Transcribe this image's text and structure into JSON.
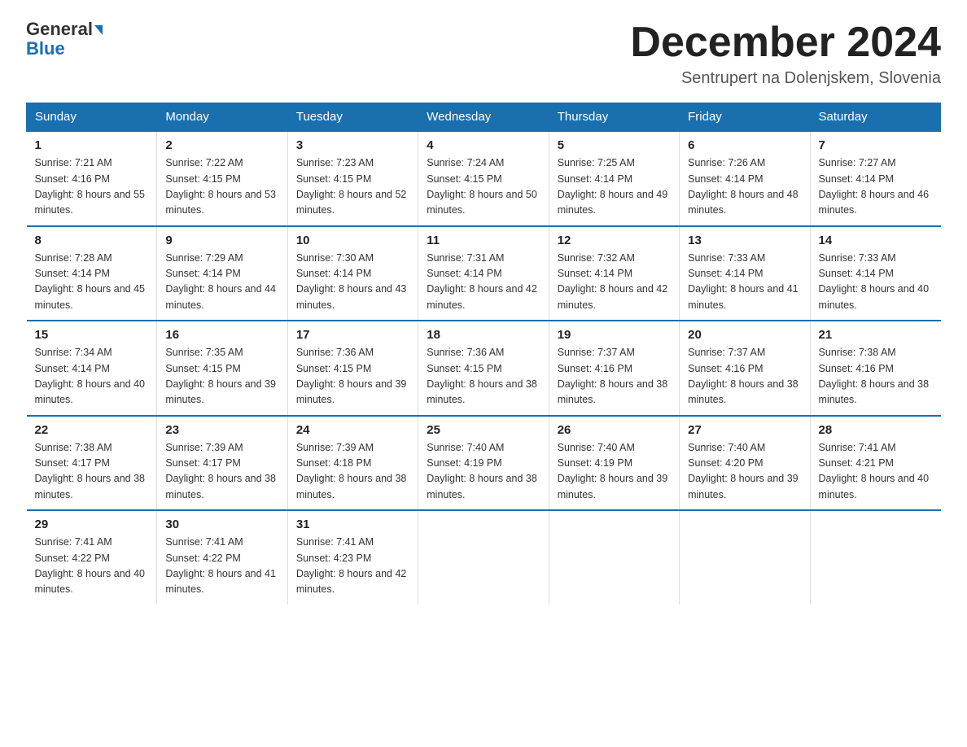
{
  "header": {
    "logo_line1": "General",
    "logo_line2": "Blue",
    "month_title": "December 2024",
    "subtitle": "Sentrupert na Dolenjskem, Slovenia"
  },
  "weekdays": [
    "Sunday",
    "Monday",
    "Tuesday",
    "Wednesday",
    "Thursday",
    "Friday",
    "Saturday"
  ],
  "weeks": [
    [
      {
        "day": "1",
        "sunrise": "7:21 AM",
        "sunset": "4:16 PM",
        "daylight": "8 hours and 55 minutes."
      },
      {
        "day": "2",
        "sunrise": "7:22 AM",
        "sunset": "4:15 PM",
        "daylight": "8 hours and 53 minutes."
      },
      {
        "day": "3",
        "sunrise": "7:23 AM",
        "sunset": "4:15 PM",
        "daylight": "8 hours and 52 minutes."
      },
      {
        "day": "4",
        "sunrise": "7:24 AM",
        "sunset": "4:15 PM",
        "daylight": "8 hours and 50 minutes."
      },
      {
        "day": "5",
        "sunrise": "7:25 AM",
        "sunset": "4:14 PM",
        "daylight": "8 hours and 49 minutes."
      },
      {
        "day": "6",
        "sunrise": "7:26 AM",
        "sunset": "4:14 PM",
        "daylight": "8 hours and 48 minutes."
      },
      {
        "day": "7",
        "sunrise": "7:27 AM",
        "sunset": "4:14 PM",
        "daylight": "8 hours and 46 minutes."
      }
    ],
    [
      {
        "day": "8",
        "sunrise": "7:28 AM",
        "sunset": "4:14 PM",
        "daylight": "8 hours and 45 minutes."
      },
      {
        "day": "9",
        "sunrise": "7:29 AM",
        "sunset": "4:14 PM",
        "daylight": "8 hours and 44 minutes."
      },
      {
        "day": "10",
        "sunrise": "7:30 AM",
        "sunset": "4:14 PM",
        "daylight": "8 hours and 43 minutes."
      },
      {
        "day": "11",
        "sunrise": "7:31 AM",
        "sunset": "4:14 PM",
        "daylight": "8 hours and 42 minutes."
      },
      {
        "day": "12",
        "sunrise": "7:32 AM",
        "sunset": "4:14 PM",
        "daylight": "8 hours and 42 minutes."
      },
      {
        "day": "13",
        "sunrise": "7:33 AM",
        "sunset": "4:14 PM",
        "daylight": "8 hours and 41 minutes."
      },
      {
        "day": "14",
        "sunrise": "7:33 AM",
        "sunset": "4:14 PM",
        "daylight": "8 hours and 40 minutes."
      }
    ],
    [
      {
        "day": "15",
        "sunrise": "7:34 AM",
        "sunset": "4:14 PM",
        "daylight": "8 hours and 40 minutes."
      },
      {
        "day": "16",
        "sunrise": "7:35 AM",
        "sunset": "4:15 PM",
        "daylight": "8 hours and 39 minutes."
      },
      {
        "day": "17",
        "sunrise": "7:36 AM",
        "sunset": "4:15 PM",
        "daylight": "8 hours and 39 minutes."
      },
      {
        "day": "18",
        "sunrise": "7:36 AM",
        "sunset": "4:15 PM",
        "daylight": "8 hours and 38 minutes."
      },
      {
        "day": "19",
        "sunrise": "7:37 AM",
        "sunset": "4:16 PM",
        "daylight": "8 hours and 38 minutes."
      },
      {
        "day": "20",
        "sunrise": "7:37 AM",
        "sunset": "4:16 PM",
        "daylight": "8 hours and 38 minutes."
      },
      {
        "day": "21",
        "sunrise": "7:38 AM",
        "sunset": "4:16 PM",
        "daylight": "8 hours and 38 minutes."
      }
    ],
    [
      {
        "day": "22",
        "sunrise": "7:38 AM",
        "sunset": "4:17 PM",
        "daylight": "8 hours and 38 minutes."
      },
      {
        "day": "23",
        "sunrise": "7:39 AM",
        "sunset": "4:17 PM",
        "daylight": "8 hours and 38 minutes."
      },
      {
        "day": "24",
        "sunrise": "7:39 AM",
        "sunset": "4:18 PM",
        "daylight": "8 hours and 38 minutes."
      },
      {
        "day": "25",
        "sunrise": "7:40 AM",
        "sunset": "4:19 PM",
        "daylight": "8 hours and 38 minutes."
      },
      {
        "day": "26",
        "sunrise": "7:40 AM",
        "sunset": "4:19 PM",
        "daylight": "8 hours and 39 minutes."
      },
      {
        "day": "27",
        "sunrise": "7:40 AM",
        "sunset": "4:20 PM",
        "daylight": "8 hours and 39 minutes."
      },
      {
        "day": "28",
        "sunrise": "7:41 AM",
        "sunset": "4:21 PM",
        "daylight": "8 hours and 40 minutes."
      }
    ],
    [
      {
        "day": "29",
        "sunrise": "7:41 AM",
        "sunset": "4:22 PM",
        "daylight": "8 hours and 40 minutes."
      },
      {
        "day": "30",
        "sunrise": "7:41 AM",
        "sunset": "4:22 PM",
        "daylight": "8 hours and 41 minutes."
      },
      {
        "day": "31",
        "sunrise": "7:41 AM",
        "sunset": "4:23 PM",
        "daylight": "8 hours and 42 minutes."
      },
      null,
      null,
      null,
      null
    ]
  ]
}
